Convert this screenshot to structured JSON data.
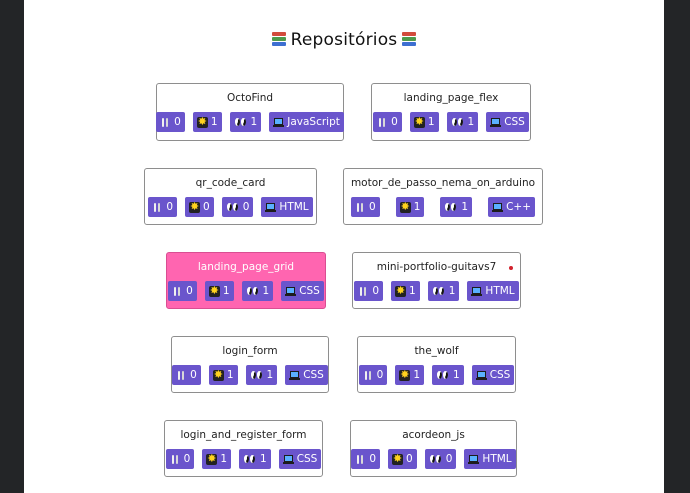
{
  "header": {
    "title": "Repositórios",
    "left_icon": "books-icon",
    "right_icon": "books-icon"
  },
  "colors": {
    "badge": "#6a55cc",
    "highlight": "#ff65b0",
    "background_outer": "#232527"
  },
  "icons": {
    "forks": "fork-icon",
    "stars": "star-icon",
    "watchers": "eyes-icon",
    "language": "laptop-icon"
  },
  "repos": [
    {
      "name": "OctoFind",
      "forks": "0",
      "stars": "1",
      "watchers": "1",
      "language": "JavaScript",
      "highlighted": false
    },
    {
      "name": "landing_page_flex",
      "forks": "0",
      "stars": "1",
      "watchers": "1",
      "language": "CSS",
      "highlighted": false
    },
    {
      "name": "qr_code_card",
      "forks": "0",
      "stars": "0",
      "watchers": "0",
      "language": "HTML",
      "highlighted": false
    },
    {
      "name": "motor_de_passo_nema_on_arduino",
      "forks": "0",
      "stars": "1",
      "watchers": "1",
      "language": "C++",
      "highlighted": false
    },
    {
      "name": "landing_page_grid",
      "forks": "0",
      "stars": "1",
      "watchers": "1",
      "language": "CSS",
      "highlighted": true
    },
    {
      "name": "mini-portfolio-guitavs7",
      "forks": "0",
      "stars": "1",
      "watchers": "1",
      "language": "HTML",
      "highlighted": false
    },
    {
      "name": "login_form",
      "forks": "0",
      "stars": "1",
      "watchers": "1",
      "language": "CSS",
      "highlighted": false
    },
    {
      "name": "the_wolf",
      "forks": "0",
      "stars": "1",
      "watchers": "1",
      "language": "CSS",
      "highlighted": false
    },
    {
      "name": "login_and_register_form",
      "forks": "0",
      "stars": "1",
      "watchers": "1",
      "language": "CSS",
      "highlighted": false
    },
    {
      "name": "acordeon_js",
      "forks": "0",
      "stars": "0",
      "watchers": "0",
      "language": "HTML",
      "highlighted": false
    }
  ]
}
